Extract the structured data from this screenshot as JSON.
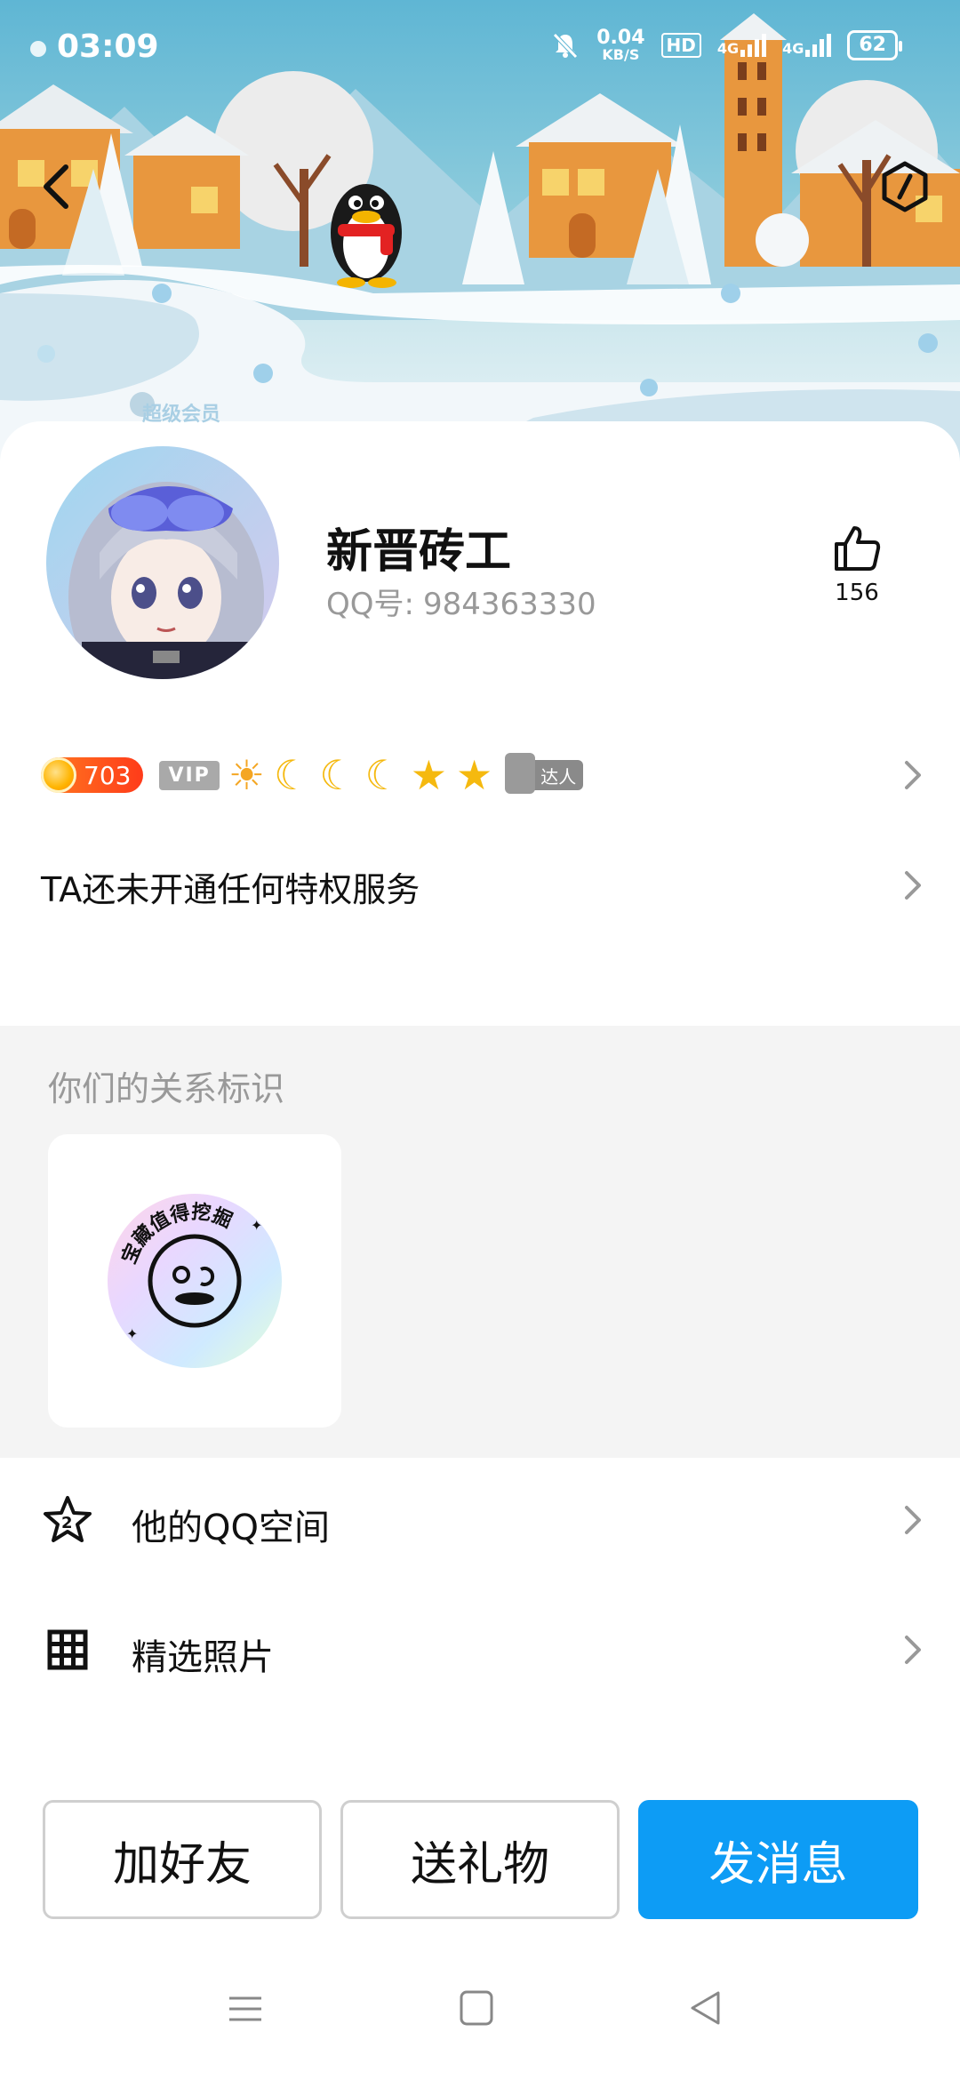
{
  "status_bar": {
    "time": "03:09",
    "net_speed": "0.04",
    "net_speed_unit": "KB/S",
    "hd_label": "HD",
    "sim1": "4G",
    "sim2": "4G",
    "battery": "62"
  },
  "banner": {
    "watermark": "超级会员"
  },
  "profile": {
    "nickname": "新晋砖工",
    "qq_label": "QQ号:",
    "qq_number": "984363330",
    "like_count": "156"
  },
  "badges": {
    "level": "703",
    "vip": "VIP",
    "talent": "达人"
  },
  "privilege": {
    "text": "TA还未开通任何特权服务"
  },
  "relation": {
    "title": "你们的关系标识",
    "badge_text": "宝藏值得挖掘"
  },
  "list": [
    {
      "label": "他的QQ空间",
      "icon": "star-icon"
    },
    {
      "label": "精选照片",
      "icon": "grid-icon"
    }
  ],
  "buttons": {
    "add_friend": "加好友",
    "send_gift": "送礼物",
    "send_message": "发消息"
  },
  "colors": {
    "primary": "#0d9cf5",
    "level_badge": "#ff5a1a",
    "section_bg": "#f4f4f4"
  }
}
